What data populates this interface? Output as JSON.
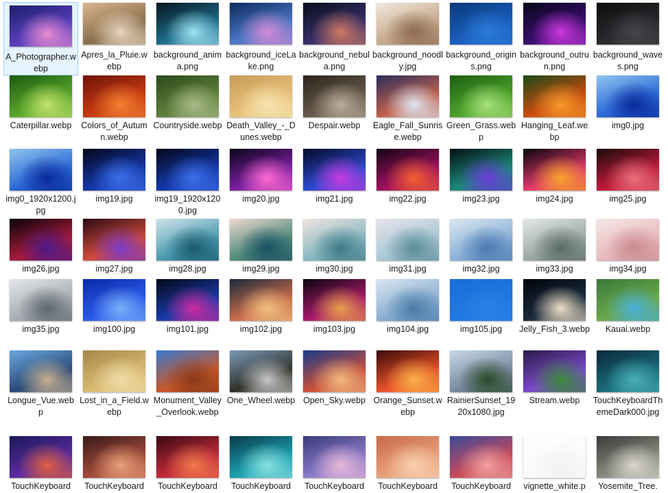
{
  "files": [
    {
      "name": "A_Photographer.webp",
      "selected": true,
      "thumb": [
        "#1b1f6a",
        "#5a3fc0",
        "#e98cd0"
      ]
    },
    {
      "name": "Apres_la_Pluie.webp",
      "thumb": [
        "#d9b58f",
        "#8a6f4c",
        "#e8d5c0"
      ]
    },
    {
      "name": "background_anima.png",
      "thumb": [
        "#06161e",
        "#1d6c8a",
        "#9fe2f2"
      ]
    },
    {
      "name": "background_iceLake.png",
      "thumb": [
        "#0d2a5e",
        "#4b78c6",
        "#d48ad4"
      ]
    },
    {
      "name": "background_nebula.png",
      "thumb": [
        "#080d1c",
        "#38306a",
        "#d07a63"
      ]
    },
    {
      "name": "background_noodly.jpg",
      "thumb": [
        "#f1e9de",
        "#c6a88a",
        "#8e6a50"
      ]
    },
    {
      "name": "background_origins.png",
      "thumb": [
        "#0a3a7a",
        "#1a5ebd",
        "#2b7ad8"
      ]
    },
    {
      "name": "background_outrun.png",
      "thumb": [
        "#07051a",
        "#3a0f6e",
        "#cc38e0"
      ]
    },
    {
      "name": "background_waves.png",
      "thumb": [
        "#0d0d0f",
        "#2a2a2e",
        "#454549"
      ]
    },
    {
      "name": "Caterpillar.webp",
      "thumb": [
        "#1c5a0e",
        "#57a52a",
        "#c3e26a"
      ]
    },
    {
      "name": "Colors_of_Autumn.webp",
      "thumb": [
        "#6e1408",
        "#c83a12",
        "#f08030"
      ]
    },
    {
      "name": "Countryside.webp",
      "thumb": [
        "#2c4a1c",
        "#5d7f3a",
        "#a9b98a"
      ]
    },
    {
      "name": "Death_Valley_-_Dunes.webp",
      "thumb": [
        "#c89a58",
        "#e9c27a",
        "#f6e4b0"
      ]
    },
    {
      "name": "Despair.webp",
      "thumb": [
        "#2b241c",
        "#66594a",
        "#b8ad9c"
      ]
    },
    {
      "name": "Eagle_Fall_Sunrise.webp",
      "thumb": [
        "#2a2e5c",
        "#c2604a",
        "#dde6f2"
      ]
    },
    {
      "name": "Green_Grass.webp",
      "thumb": [
        "#1f5e12",
        "#4aa22a",
        "#a8e07a"
      ]
    },
    {
      "name": "Hanging_Leaf.webp",
      "thumb": [
        "#1d4a16",
        "#ca4a10",
        "#f59a2a"
      ]
    },
    {
      "name": "img0.jpg",
      "thumb": [
        "#8fc4ef",
        "#2a68d6",
        "#0a2a9a"
      ]
    },
    {
      "name": "img0_1920x1200.jpg",
      "thumb": [
        "#8fc4ef",
        "#2a68d6",
        "#0a2a9a"
      ]
    },
    {
      "name": "img19.jpg",
      "thumb": [
        "#03061a",
        "#1438a8",
        "#3c6fe8"
      ]
    },
    {
      "name": "img19_1920x1200.jpg",
      "thumb": [
        "#03061a",
        "#1438a8",
        "#3c6fe8"
      ]
    },
    {
      "name": "img20.jpg",
      "thumb": [
        "#090418",
        "#7a1fa0",
        "#ff6ad0"
      ]
    },
    {
      "name": "img21.jpg",
      "thumb": [
        "#050a26",
        "#2a4ad0",
        "#c83ae0"
      ]
    },
    {
      "name": "img22.jpg",
      "thumb": [
        "#120414",
        "#a01060",
        "#f46030"
      ]
    },
    {
      "name": "img23.jpg",
      "thumb": [
        "#040f12",
        "#1a8a7a",
        "#6a3ad8"
      ]
    },
    {
      "name": "img24.jpg",
      "thumb": [
        "#06040c",
        "#e03a6a",
        "#f6a42a"
      ]
    },
    {
      "name": "img25.jpg",
      "thumb": [
        "#1a0a0c",
        "#c01a3a",
        "#e8707a"
      ]
    },
    {
      "name": "img26.jpg",
      "thumb": [
        "#08040a",
        "#a81a3a",
        "#4a1a8a"
      ]
    },
    {
      "name": "img27.jpg",
      "thumb": [
        "#2a0a14",
        "#d04a3a",
        "#7a3ac8"
      ]
    },
    {
      "name": "img28.jpg",
      "thumb": [
        "#cfe4ea",
        "#4a9ab0",
        "#1a5a6e"
      ]
    },
    {
      "name": "img29.jpg",
      "thumb": [
        "#f0d8d0",
        "#4e8a7a",
        "#1a5062"
      ]
    },
    {
      "name": "img30.jpg",
      "thumb": [
        "#f0e4e0",
        "#88b8c0",
        "#3e7a88"
      ]
    },
    {
      "name": "img31.jpg",
      "thumb": [
        "#e8e4ec",
        "#a8c8d4",
        "#5a8a98"
      ]
    },
    {
      "name": "img32.jpg",
      "thumb": [
        "#dce8f0",
        "#8ab0d8",
        "#4a78b0"
      ]
    },
    {
      "name": "img33.jpg",
      "thumb": [
        "#e4e8e6",
        "#9aa8a2",
        "#5c6a64"
      ]
    },
    {
      "name": "img34.jpg",
      "thumb": [
        "#f6e8e8",
        "#e8b8bc",
        "#c88a90"
      ]
    },
    {
      "name": "img35.jpg",
      "thumb": [
        "#e4e6e8",
        "#a8aeb4",
        "#5e666e"
      ]
    },
    {
      "name": "img100.jpg",
      "thumb": [
        "#0a2aa8",
        "#2a5ae8",
        "#7ab0f8"
      ]
    },
    {
      "name": "img101.jpg",
      "thumb": [
        "#030818",
        "#1a3aa8",
        "#d02aa0"
      ]
    },
    {
      "name": "img102.jpg",
      "thumb": [
        "#1a2a3c",
        "#c86a4a",
        "#f0c080"
      ]
    },
    {
      "name": "img103.jpg",
      "thumb": [
        "#0a0610",
        "#a81a6a",
        "#e8a04a"
      ]
    },
    {
      "name": "img104.jpg",
      "thumb": [
        "#d8e4f0",
        "#8ab0d0",
        "#4a7aa8"
      ]
    },
    {
      "name": "img105.jpg",
      "thumb": [
        "#1a6ed8",
        "#1f78e0",
        "#2a82e8"
      ]
    },
    {
      "name": "Jelly_Fish_3.webp",
      "thumb": [
        "#02060e",
        "#1a2a3a",
        "#f0e0c8"
      ]
    },
    {
      "name": "Kauai.webp",
      "thumb": [
        "#3a7a3a",
        "#6aa84a",
        "#4ab0d8"
      ]
    },
    {
      "name": "Longue_Vue.webp",
      "thumb": [
        "#6aa8e0",
        "#2a4a78",
        "#c8b090"
      ]
    },
    {
      "name": "Lost_in_a_Field.webp",
      "thumb": [
        "#a8884a",
        "#d8b870",
        "#f0dca8"
      ]
    },
    {
      "name": "Monument_Valley_Overlook.webp",
      "thumb": [
        "#3a7ad0",
        "#c8582a",
        "#8a3a1a"
      ]
    },
    {
      "name": "One_Wheel.webp",
      "thumb": [
        "#7a9ab8",
        "#30302a",
        "#c8c8c8"
      ]
    },
    {
      "name": "Open_Sky.webp",
      "thumb": [
        "#1a3a8a",
        "#c8503a",
        "#f0b880"
      ]
    },
    {
      "name": "Orange_Sunset.webp",
      "thumb": [
        "#3a0a08",
        "#e8502a",
        "#f8b048"
      ]
    },
    {
      "name": "RainierSunset_1920x1080.jpg",
      "thumb": [
        "#c8d8e8",
        "#7a8aa0",
        "#2a4a2a"
      ]
    },
    {
      "name": "Stream.webp",
      "thumb": [
        "#2a1a4a",
        "#7a4ac8",
        "#3a8a3a"
      ]
    },
    {
      "name": "TouchKeyboardThemeDark000.jpg",
      "thumb": [
        "#0a2a3a",
        "#1a6a7a",
        "#4ab0b8"
      ]
    },
    {
      "name": "TouchKeyboard",
      "thumb": [
        "#1a1a5a",
        "#5a2aa0",
        "#e06040"
      ]
    },
    {
      "name": "TouchKeyboard",
      "thumb": [
        "#3a1a1a",
        "#a04a3a",
        "#e8a07a"
      ]
    },
    {
      "name": "TouchKeyboard",
      "thumb": [
        "#3a0a14",
        "#c02a3a",
        "#f07a4a"
      ]
    },
    {
      "name": "TouchKeyboard",
      "thumb": [
        "#0a3a4a",
        "#1aa0b0",
        "#8ae0e0"
      ]
    },
    {
      "name": "TouchKeyboard",
      "thumb": [
        "#3a3a7a",
        "#8a7ac8",
        "#e8b8d8"
      ]
    },
    {
      "name": "TouchKeyboard",
      "thumb": [
        "#c86a4a",
        "#e8a07a",
        "#f8d0b0"
      ]
    },
    {
      "name": "TouchKeyboard",
      "thumb": [
        "#3a4a9a",
        "#c84a5a",
        "#f0a0a0"
      ]
    },
    {
      "name": "vignette_white.p",
      "thumb": [
        "#ffffff",
        "#fafafa",
        "#f2f2f2"
      ]
    },
    {
      "name": "Yosemite_Tree.",
      "thumb": [
        "#3a3a38",
        "#8a8a80",
        "#d8d6cc"
      ]
    }
  ]
}
